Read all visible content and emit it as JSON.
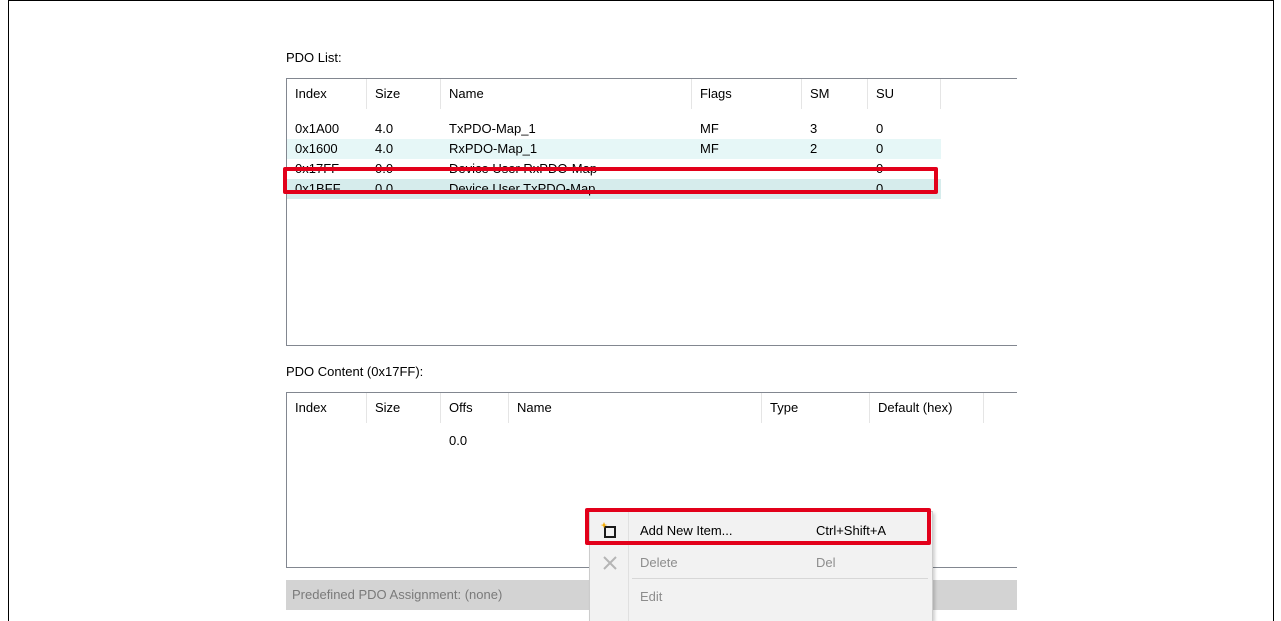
{
  "pdo_list": {
    "label": "PDO List:",
    "columns": [
      "Index",
      "Size",
      "Name",
      "Flags",
      "SM",
      "SU"
    ],
    "rows": [
      {
        "index": "0x1A00",
        "size": "4.0",
        "name": "TxPDO-Map_1",
        "flags": "MF",
        "sm": "3",
        "su": "0"
      },
      {
        "index": "0x1600",
        "size": "4.0",
        "name": "RxPDO-Map_1",
        "flags": "MF",
        "sm": "2",
        "su": "0"
      },
      {
        "index": "0x17FF",
        "size": "0.0",
        "name": "Device User RxPDO-Map",
        "flags": "",
        "sm": "",
        "su": "0"
      },
      {
        "index": "0x1BFF",
        "size": "0.0",
        "name": "Device User TxPDO-Map",
        "flags": "",
        "sm": "",
        "su": "0"
      }
    ]
  },
  "pdo_content": {
    "label": "PDO Content (0x17FF):",
    "columns": [
      "Index",
      "Size",
      "Offs",
      "Name",
      "Type",
      "Default (hex)"
    ],
    "rows": [
      {
        "offs": "0.0"
      }
    ]
  },
  "status_bar": {
    "text": "Predefined PDO Assignment: (none)"
  },
  "context_menu": {
    "items": [
      {
        "label": "Add New Item...",
        "shortcut": "Ctrl+Shift+A",
        "icon": "add-item-icon",
        "enabled": true
      },
      {
        "label": "Delete",
        "shortcut": "Del",
        "icon": "delete-icon",
        "enabled": false
      },
      {
        "label": "Edit",
        "shortcut": "",
        "icon": "",
        "enabled": false
      }
    ]
  },
  "colors": {
    "highlight": "#e2001a",
    "row_alt": "#e6f7f7",
    "row_teal": "#d6ecec",
    "menu_bg": "#f2f2f2",
    "status_bg": "#d3d3d3"
  }
}
